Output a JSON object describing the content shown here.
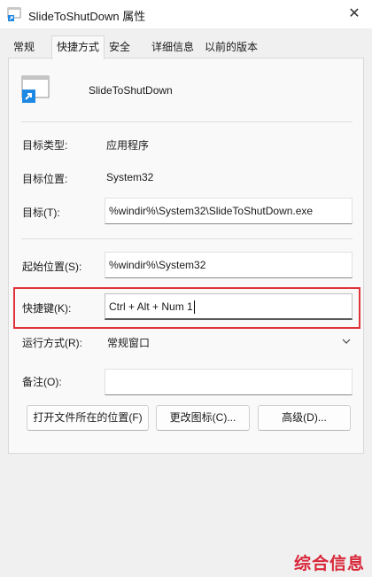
{
  "window": {
    "title": "SlideToShutDown 属性",
    "close_glyph": "✕"
  },
  "tabs": [
    {
      "label": "常规",
      "active": false
    },
    {
      "label": "快捷方式",
      "active": true
    },
    {
      "label": "安全",
      "active": false
    },
    {
      "label": "详细信息",
      "active": false
    },
    {
      "label": "以前的版本",
      "active": false
    }
  ],
  "shortcut": {
    "app_name": "SlideToShutDown",
    "target_type_label": "目标类型:",
    "target_type_value": "应用程序",
    "target_location_label": "目标位置:",
    "target_location_value": "System32",
    "target_label": "目标(T):",
    "target_value": "%windir%\\System32\\SlideToShutDown.exe",
    "start_in_label": "起始位置(S):",
    "start_in_value": "%windir%\\System32",
    "hotkey_label": "快捷键(K):",
    "hotkey_value": "Ctrl + Alt + Num 1",
    "run_label": "运行方式(R):",
    "run_value": "常规窗口",
    "comment_label": "备注(O):",
    "comment_value": "",
    "open_location_button": "打开文件所在的位置(F)",
    "change_icon_button": "更改图标(C)...",
    "advanced_button": "高级(D)..."
  },
  "watermark": "综合信息",
  "colors": {
    "highlight": "#e0333a",
    "watermark": "#d8283a",
    "icon_blue": "#1e88e5"
  },
  "icons": {
    "title_icon": "shortcut-icon",
    "app_icon": "shortcut-icon",
    "dropdown": "chevron-down-icon"
  }
}
